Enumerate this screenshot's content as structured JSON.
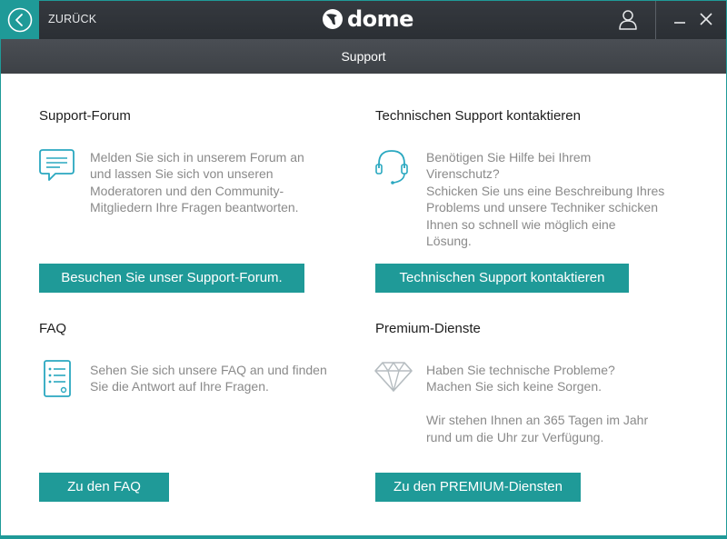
{
  "titlebar": {
    "back_label": "ZURÜCK",
    "logo_text": "dome",
    "accent_color": "#1f9a98"
  },
  "subheader": {
    "title": "Support"
  },
  "sections": [
    {
      "title": "Support-Forum",
      "icon": "chat-bubble-icon",
      "lines": [
        "Melden Sie sich in unserem Forum an",
        "und lassen Sie sich von unseren",
        "Moderatoren und den Community-",
        "Mitgliedern Ihre Fragen beantworten."
      ],
      "button": "Besuchen Sie unser Support-Forum."
    },
    {
      "title": "Technischen Support kontaktieren",
      "icon": "headset-icon",
      "lines": [
        "Benötigen Sie Hilfe bei Ihrem",
        "Virenschutz?",
        "Schicken Sie uns eine Beschreibung Ihres",
        "Problems und unsere Techniker schicken",
        "Ihnen so schnell wie möglich eine",
        "Lösung."
      ],
      "button": "Technischen Support kontaktieren"
    },
    {
      "title": "FAQ",
      "icon": "document-list-icon",
      "lines": [
        "Sehen Sie sich unsere FAQ an und finden",
        "Sie die Antwort auf Ihre Fragen."
      ],
      "button": "Zu den FAQ"
    },
    {
      "title": "Premium-Dienste",
      "icon": "diamond-icon",
      "lines": [
        "Haben Sie technische Probleme?",
        "Machen Sie sich keine Sorgen.",
        "",
        "Wir stehen Ihnen an 365 Tagen im Jahr",
        "rund um die Uhr zur Verfügung."
      ],
      "button": "Zu den PREMIUM-Diensten"
    }
  ]
}
